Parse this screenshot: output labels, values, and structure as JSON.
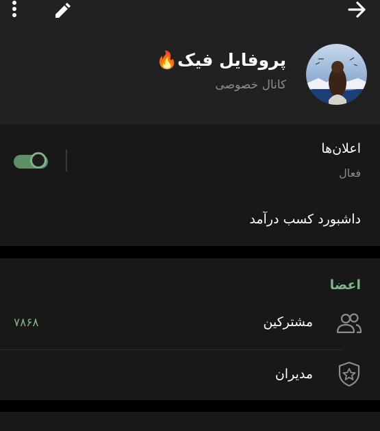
{
  "header": {
    "title": "پروفایل فیک🔥",
    "subtitle": "کانال خصوصی",
    "icons": [
      "more-vertical-icon",
      "edit-pencil-icon",
      "arrow-right-icon"
    ]
  },
  "settings": {
    "notifications_label": "اعلان‌ها",
    "notifications_state": "فعال",
    "revenue_dashboard_label": "داشبورد کسب درآمد"
  },
  "members": {
    "section_title": "اعضا",
    "subscribers_label": "مشترکین",
    "subscribers_count": "۷۸۶۸",
    "admins_label": "مدیران"
  },
  "colors": {
    "accent_green": "#7fb58a",
    "header_bg": "#212121",
    "section_bg": "#181818"
  }
}
